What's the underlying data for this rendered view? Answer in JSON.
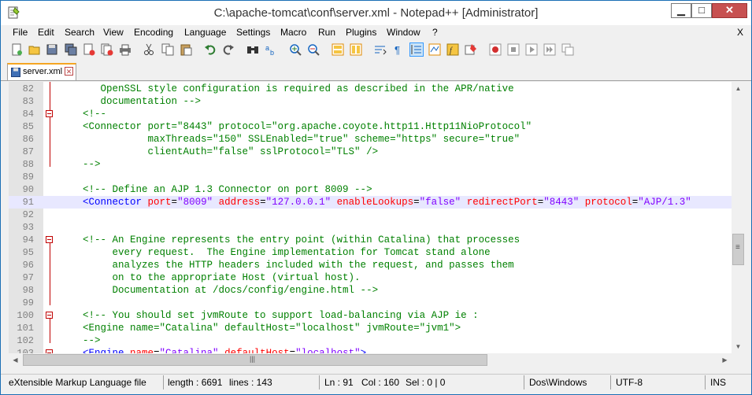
{
  "window": {
    "title": "C:\\apache-tomcat\\conf\\server.xml - Notepad++ [Administrator]",
    "minimize": "▁",
    "maximize": "□",
    "close": "✕"
  },
  "menu": {
    "items": [
      "File",
      "Edit",
      "Search",
      "View",
      "Encoding",
      "Language",
      "Settings",
      "Macro",
      "Run",
      "Plugins",
      "Window",
      "?"
    ],
    "close_doc": "X"
  },
  "tab": {
    "label": "server.xml",
    "close": "✕"
  },
  "editor": {
    "lines": [
      {
        "n": "82",
        "fold": false,
        "current": false,
        "parts": [
          {
            "t": "       OpenSSL style configuration is required as described in the APR/native",
            "c": "c-cmt"
          }
        ]
      },
      {
        "n": "83",
        "fold": false,
        "current": false,
        "parts": [
          {
            "t": "       documentation -->",
            "c": "c-cmt"
          }
        ]
      },
      {
        "n": "84",
        "fold": true,
        "current": false,
        "parts": [
          {
            "t": "    <!--",
            "c": "c-cmt"
          }
        ]
      },
      {
        "n": "85",
        "fold": false,
        "current": false,
        "parts": [
          {
            "t": "    <Connector port=\"8443\" protocol=\"org.apache.coyote.http11.Http11NioProtocol\"",
            "c": "c-cmt"
          }
        ]
      },
      {
        "n": "86",
        "fold": false,
        "current": false,
        "parts": [
          {
            "t": "               maxThreads=\"150\" SSLEnabled=\"true\" scheme=\"https\" secure=\"true\"",
            "c": "c-cmt"
          }
        ]
      },
      {
        "n": "87",
        "fold": false,
        "current": false,
        "parts": [
          {
            "t": "               clientAuth=\"false\" sslProtocol=\"TLS\" />",
            "c": "c-cmt"
          }
        ]
      },
      {
        "n": "88",
        "fold": false,
        "current": false,
        "parts": [
          {
            "t": "    -->",
            "c": "c-cmt"
          }
        ]
      },
      {
        "n": "89",
        "fold": false,
        "current": false,
        "parts": [
          {
            "t": "",
            "c": "c-txt"
          }
        ]
      },
      {
        "n": "90",
        "fold": false,
        "current": false,
        "parts": [
          {
            "t": "    <!-- Define an AJP 1.3 Connector on port 8009 -->",
            "c": "c-cmt"
          }
        ]
      },
      {
        "n": "91",
        "fold": false,
        "current": true,
        "parts": [
          {
            "t": "    <Connector ",
            "c": "c-tag"
          },
          {
            "t": "port",
            "c": "c-attr"
          },
          {
            "t": "=",
            "c": "c-txt"
          },
          {
            "t": "\"8009\" ",
            "c": "c-val"
          },
          {
            "t": "address",
            "c": "c-attr"
          },
          {
            "t": "=",
            "c": "c-txt"
          },
          {
            "t": "\"127.0.0.1\" ",
            "c": "c-val"
          },
          {
            "t": "enableLookups",
            "c": "c-attr"
          },
          {
            "t": "=",
            "c": "c-txt"
          },
          {
            "t": "\"false\" ",
            "c": "c-val"
          },
          {
            "t": "redirectPort",
            "c": "c-attr"
          },
          {
            "t": "=",
            "c": "c-txt"
          },
          {
            "t": "\"8443\" ",
            "c": "c-val"
          },
          {
            "t": "protocol",
            "c": "c-attr"
          },
          {
            "t": "=",
            "c": "c-txt"
          },
          {
            "t": "\"AJP/1.3\"",
            "c": "c-val"
          }
        ]
      },
      {
        "n": "92",
        "fold": false,
        "current": false,
        "parts": [
          {
            "t": "",
            "c": "c-txt"
          }
        ]
      },
      {
        "n": "93",
        "fold": false,
        "current": false,
        "parts": [
          {
            "t": "",
            "c": "c-txt"
          }
        ]
      },
      {
        "n": "94",
        "fold": true,
        "current": false,
        "parts": [
          {
            "t": "    <!-- An Engine represents the entry point (within Catalina) that processes",
            "c": "c-cmt"
          }
        ]
      },
      {
        "n": "95",
        "fold": false,
        "current": false,
        "parts": [
          {
            "t": "         every request.  The Engine implementation for Tomcat stand alone",
            "c": "c-cmt"
          }
        ]
      },
      {
        "n": "96",
        "fold": false,
        "current": false,
        "parts": [
          {
            "t": "         analyzes the HTTP headers included with the request, and passes them",
            "c": "c-cmt"
          }
        ]
      },
      {
        "n": "97",
        "fold": false,
        "current": false,
        "parts": [
          {
            "t": "         on to the appropriate Host (virtual host).",
            "c": "c-cmt"
          }
        ]
      },
      {
        "n": "98",
        "fold": false,
        "current": false,
        "parts": [
          {
            "t": "         Documentation at /docs/config/engine.html -->",
            "c": "c-cmt"
          }
        ]
      },
      {
        "n": "99",
        "fold": false,
        "current": false,
        "parts": [
          {
            "t": "",
            "c": "c-txt"
          }
        ]
      },
      {
        "n": "100",
        "fold": true,
        "current": false,
        "parts": [
          {
            "t": "    <!-- You should set jvmRoute to support load-balancing via AJP ie :",
            "c": "c-cmt"
          }
        ]
      },
      {
        "n": "101",
        "fold": false,
        "current": false,
        "parts": [
          {
            "t": "    <Engine name=\"Catalina\" defaultHost=\"localhost\" jvmRoute=\"jvm1\">",
            "c": "c-cmt"
          }
        ]
      },
      {
        "n": "102",
        "fold": false,
        "current": false,
        "parts": [
          {
            "t": "    -->",
            "c": "c-cmt"
          }
        ]
      },
      {
        "n": "103",
        "fold": true,
        "current": false,
        "parts": [
          {
            "t": "    <Engine ",
            "c": "c-tag"
          },
          {
            "t": "name",
            "c": "c-attr"
          },
          {
            "t": "=",
            "c": "c-txt"
          },
          {
            "t": "\"Catalina\" ",
            "c": "c-val"
          },
          {
            "t": "defaultHost",
            "c": "c-attr"
          },
          {
            "t": "=",
            "c": "c-txt"
          },
          {
            "t": "\"localhost\"",
            "c": "c-val"
          },
          {
            "t": ">",
            "c": "c-tag"
          }
        ]
      }
    ]
  },
  "scrollbar": {
    "up": "▲",
    "down": "▼",
    "left": "◀",
    "right": "▶",
    "grip": "≡",
    "hgrip": "|||"
  },
  "status": {
    "file_type": "eXtensible Markup Language file",
    "length": "length : 6691",
    "lines": "lines : 143",
    "ln": "Ln : 91",
    "col": "Col : 160",
    "sel": "Sel : 0 | 0",
    "eol": "Dos\\Windows",
    "encoding": "UTF-8",
    "mode": "INS"
  },
  "colors": {
    "comment": "#008000",
    "tag": "#0000ff",
    "attribute": "#ff0000",
    "value": "#8000ff",
    "fold_marker": "#c00000",
    "tab_accent": "#f5a623"
  },
  "toolbar_icons": [
    "new-file-icon",
    "open-file-icon",
    "save-icon",
    "save-all-icon",
    "close-icon",
    "close-all-icon",
    "print-icon",
    "cut-icon",
    "copy-icon",
    "paste-icon",
    "undo-icon",
    "redo-icon",
    "find-icon",
    "replace-icon",
    "zoom-in-icon",
    "zoom-out-icon",
    "sync-vertical-icon",
    "sync-horizontal-icon",
    "word-wrap-icon",
    "show-all-chars-icon",
    "indent-guide-icon",
    "doc-map-icon",
    "function-list-icon",
    "folder-workspace-icon",
    "monitoring-icon",
    "record-macro-icon",
    "stop-macro-icon",
    "play-macro-icon",
    "run-macro-multiple-icon",
    "save-macro-icon"
  ]
}
